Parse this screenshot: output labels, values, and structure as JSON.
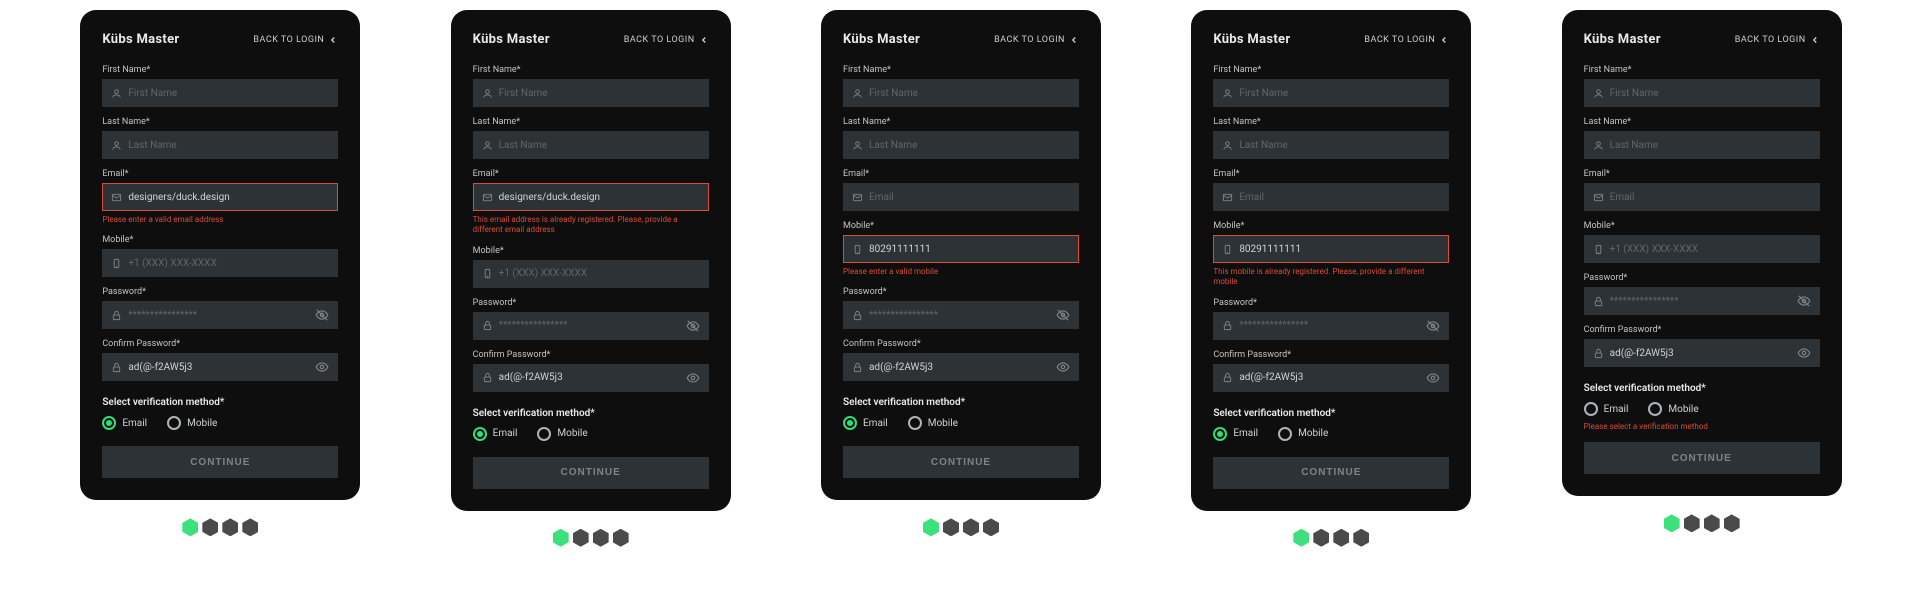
{
  "brand": "Kübs Master",
  "back_label": "BACK TO LOGIN",
  "labels": {
    "first_name": "First Name*",
    "last_name": "Last Name*",
    "email": "Email*",
    "mobile": "Mobile*",
    "password": "Password*",
    "confirm_password": "Confirm Password*",
    "verify": "Select verification method*",
    "continue": "CONTINUE",
    "radio_email": "Email",
    "radio_mobile": "Mobile"
  },
  "placeholders": {
    "first_name": "First Name",
    "last_name": "Last Name",
    "email": "Email",
    "mobile": "+1 (XXX) XXX-XXXX",
    "password": "****************",
    "confirm_password": "ad(@-f2AW5j3"
  },
  "cards": [
    {
      "email_value": "designers/duck.design",
      "email_error": "Please enter a valid email address",
      "mobile_value": "",
      "mobile_error": "",
      "radio_selected": "email",
      "verify_error": ""
    },
    {
      "email_value": "designers/duck.design",
      "email_error": "This email address is already registered. Please, provide a different email address",
      "mobile_value": "",
      "mobile_error": "",
      "radio_selected": "email",
      "verify_error": ""
    },
    {
      "email_value": "",
      "email_error": "",
      "mobile_value": "80291111111",
      "mobile_error": "Please enter a valid mobile",
      "radio_selected": "email",
      "verify_error": ""
    },
    {
      "email_value": "",
      "email_error": "",
      "mobile_value": "80291111111",
      "mobile_error": "This mobile is already registered. Please, provide a different mobile",
      "radio_selected": "email",
      "verify_error": ""
    },
    {
      "email_value": "",
      "email_error": "",
      "mobile_value": "",
      "mobile_error": "",
      "radio_selected": "",
      "verify_error": "Please select a verification method"
    }
  ]
}
